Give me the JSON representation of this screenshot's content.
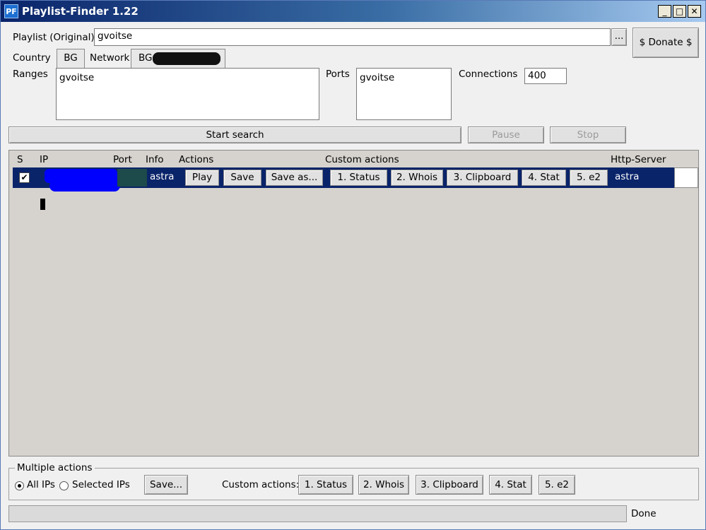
{
  "window": {
    "icon_text": "PF",
    "title": "Playlist-Finder 1.22",
    "minimize": "_",
    "maximize": "□",
    "close": "✕"
  },
  "playlist": {
    "label": "Playlist (Original):",
    "value": "gvoitse",
    "browse": "...",
    "donate": "$ Donate $"
  },
  "filters": {
    "country_label": "Country",
    "country_tab": "BG",
    "network_label": "Network",
    "network_tab": "BG-",
    "ranges_label": "Ranges",
    "ranges_value": "gvoitse",
    "ports_label": "Ports",
    "ports_value": "gvoitse",
    "connections_label": "Connections",
    "connections_value": "400"
  },
  "search": {
    "start": "Start search",
    "pause": "Pause",
    "stop": "Stop"
  },
  "results": {
    "columns": {
      "s": "S",
      "ip": "IP",
      "port": "Port",
      "info": "Info",
      "actions": "Actions",
      "custom": "Custom actions",
      "http": "Http-Server"
    },
    "rows": [
      {
        "checked": "✔",
        "info": "astra",
        "play": "Play",
        "save": "Save",
        "save_as": "Save as...",
        "status": "1. Status",
        "whois": "2. Whois",
        "clipboard": "3. Clipboard",
        "stat": "4. Stat",
        "e2": "5. e2",
        "http_server": "astra"
      }
    ]
  },
  "multiple": {
    "title": "Multiple actions",
    "all_ips": "All IPs",
    "selected_ips": "Selected IPs",
    "save": "Save...",
    "custom_label": "Custom actions:",
    "status": "1. Status",
    "whois": "2. Whois",
    "clipboard": "3. Clipboard",
    "stat": "4. Stat",
    "e2": "5. e2"
  },
  "status": {
    "text": "Done"
  }
}
